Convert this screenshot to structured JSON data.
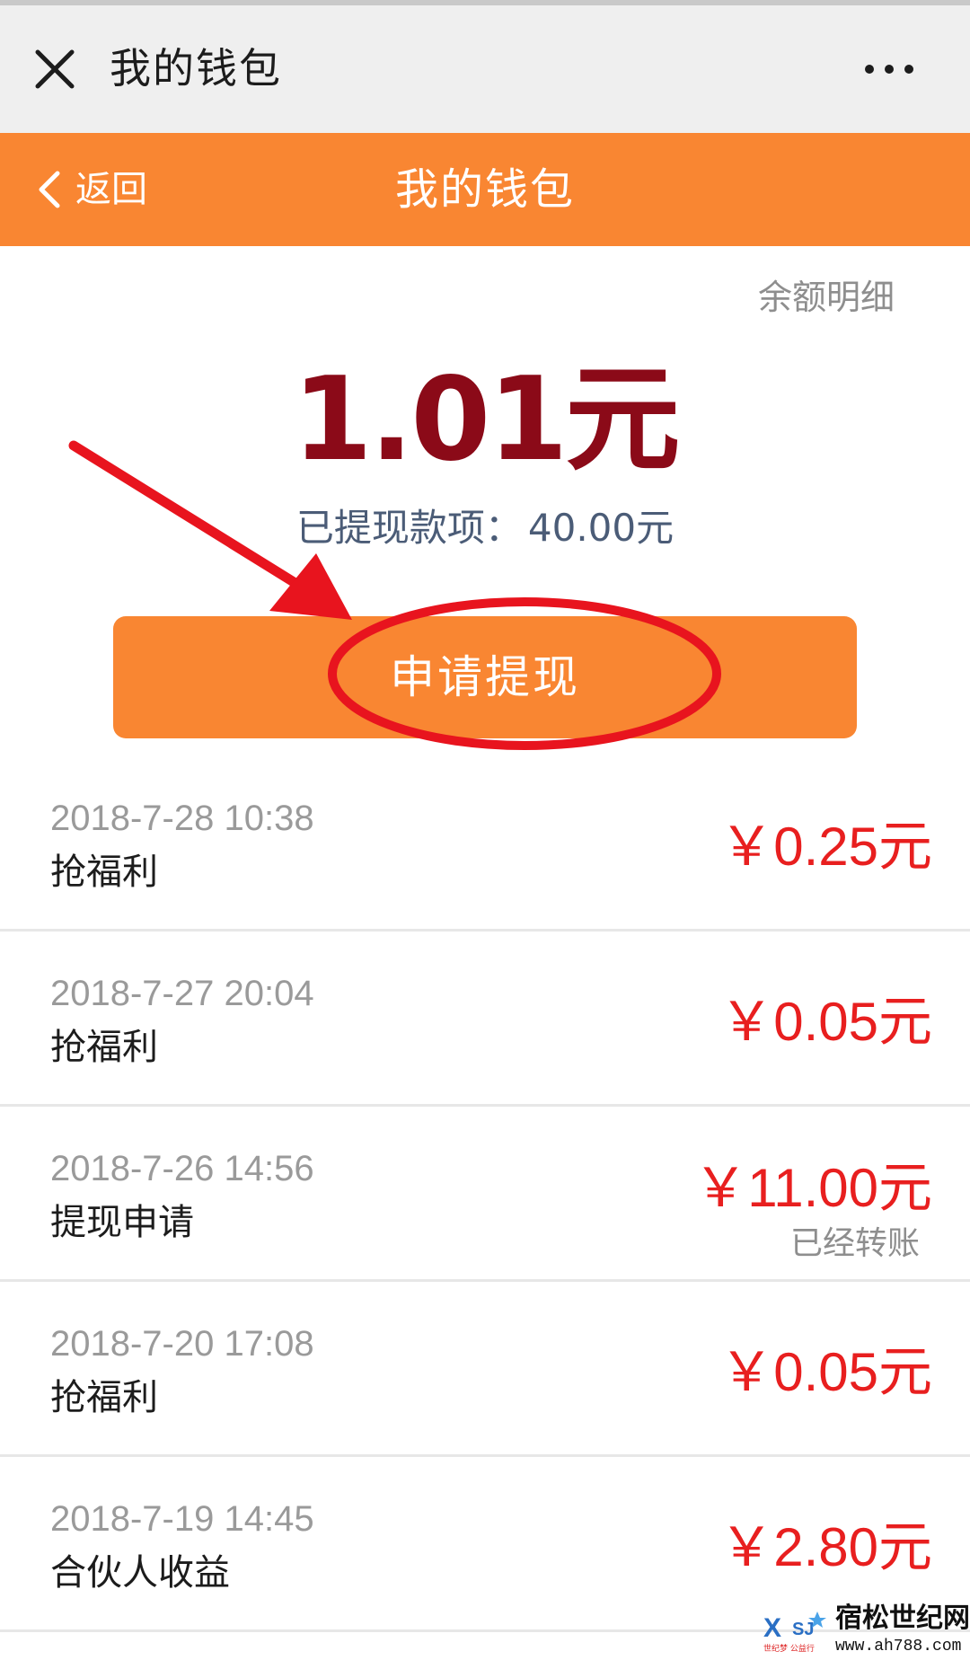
{
  "wechat_bar": {
    "title": "我的钱包",
    "close_icon": "close-icon",
    "more_icon": "more-icon"
  },
  "nav": {
    "back_label": "返回",
    "title": "我的钱包",
    "back_icon": "chevron-left-icon"
  },
  "wallet": {
    "detail_link": "余额明细",
    "balance": "1.01元",
    "withdrawn_label": "已提现款项：",
    "withdrawn_value": "40.00元",
    "withdraw_button": "申请提现"
  },
  "transactions": [
    {
      "time": "2018-7-28 10:38",
      "desc": "抢福利",
      "amount": "￥0.25元",
      "note": ""
    },
    {
      "time": "2018-7-27 20:04",
      "desc": "抢福利",
      "amount": "￥0.05元",
      "note": ""
    },
    {
      "time": "2018-7-26 14:56",
      "desc": "提现申请",
      "amount": "￥11.00元",
      "note": "已经转账"
    },
    {
      "time": "2018-7-20 17:08",
      "desc": "抢福利",
      "amount": "￥0.05元",
      "note": ""
    },
    {
      "time": "2018-7-19 14:45",
      "desc": "合伙人收益",
      "amount": "￥2.80元",
      "note": ""
    }
  ],
  "watermark": {
    "site_name": "宿松世纪网",
    "url": "www.ah788.com",
    "logo_text": "世纪梦 公益行"
  },
  "colors": {
    "accent_orange": "#f98632",
    "balance_red": "#8b0a18",
    "amount_red": "#e81f1f",
    "annotation_red": "#e8141e"
  }
}
